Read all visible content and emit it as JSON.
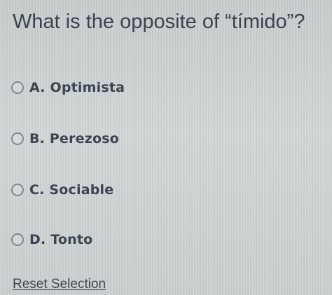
{
  "question": {
    "text": "What is the opposite of “tímido”?"
  },
  "options": [
    {
      "label": "A. Optimista",
      "selected": false
    },
    {
      "label": "B. Perezoso",
      "selected": false
    },
    {
      "label": "C. Sociable",
      "selected": false
    },
    {
      "label": "D. Tonto",
      "selected": false
    }
  ],
  "reset": {
    "label": "Reset Selection"
  },
  "colors": {
    "background": "#ced2d3",
    "text": "#3b4450",
    "radio_border": "#7f8893"
  }
}
